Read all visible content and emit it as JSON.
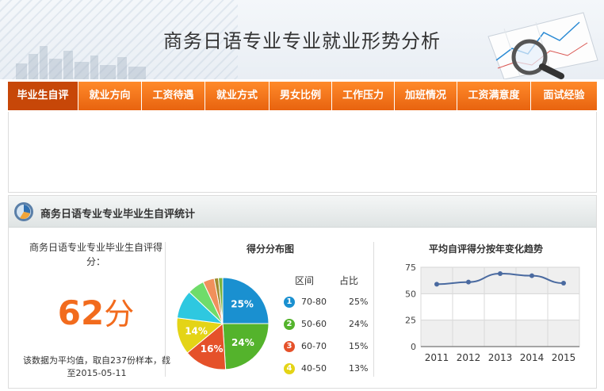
{
  "header": {
    "title": "商务日语专业专业就业形势分析"
  },
  "nav": {
    "items": [
      {
        "label": "毕业生自评",
        "active": true
      },
      {
        "label": "就业方向"
      },
      {
        "label": "工资待遇"
      },
      {
        "label": "就业方式"
      },
      {
        "label": "男女比例"
      },
      {
        "label": "工作压力"
      },
      {
        "label": "加班情况"
      },
      {
        "label": "工资满意度"
      },
      {
        "label": "面试经验"
      }
    ]
  },
  "section": {
    "title": "商务日语专业专业毕业生自评统计"
  },
  "score": {
    "label": "商务日语专业专业毕业生自评得分：",
    "value": "62",
    "unit": "分",
    "note": "该数据为平均值，取自237份样本，截至2015-05-11"
  },
  "chart_data": [
    {
      "type": "pie",
      "title": "得分分布图",
      "legend_headers": [
        "区间",
        "占比"
      ],
      "slices": [
        {
          "index": "1",
          "label": "70-80",
          "value": 25,
          "display": "25%",
          "color": "#1a90d0"
        },
        {
          "index": "2",
          "label": "50-60",
          "value": 24,
          "display": "24%",
          "color": "#54b32c"
        },
        {
          "index": "3",
          "label": "60-70",
          "value": 15,
          "display": "15%",
          "color": "#e5512a"
        },
        {
          "index": "4",
          "label": "40-50",
          "value": 13,
          "display": "13%",
          "color": "#e4d416"
        },
        {
          "value": 10,
          "color": "#2ec8e0"
        },
        {
          "value": 6,
          "color": "#6fdc6a"
        },
        {
          "value": 4,
          "color": "#f0905c"
        },
        {
          "value": 1.5,
          "color": "#a08c30"
        },
        {
          "value": 1.5,
          "color": "#7bb43c"
        }
      ],
      "pie_labels": [
        "25%",
        "24%",
        "16%",
        "14%"
      ]
    },
    {
      "type": "line",
      "title": "平均自评得分按年变化趋势",
      "x": [
        "2011",
        "2012",
        "2013",
        "2014",
        "2015"
      ],
      "values": [
        59,
        61,
        69,
        67,
        60
      ],
      "yticks": [
        0,
        25,
        50,
        75
      ],
      "ylim": [
        0,
        75
      ],
      "color": "#4a6aa0"
    }
  ]
}
